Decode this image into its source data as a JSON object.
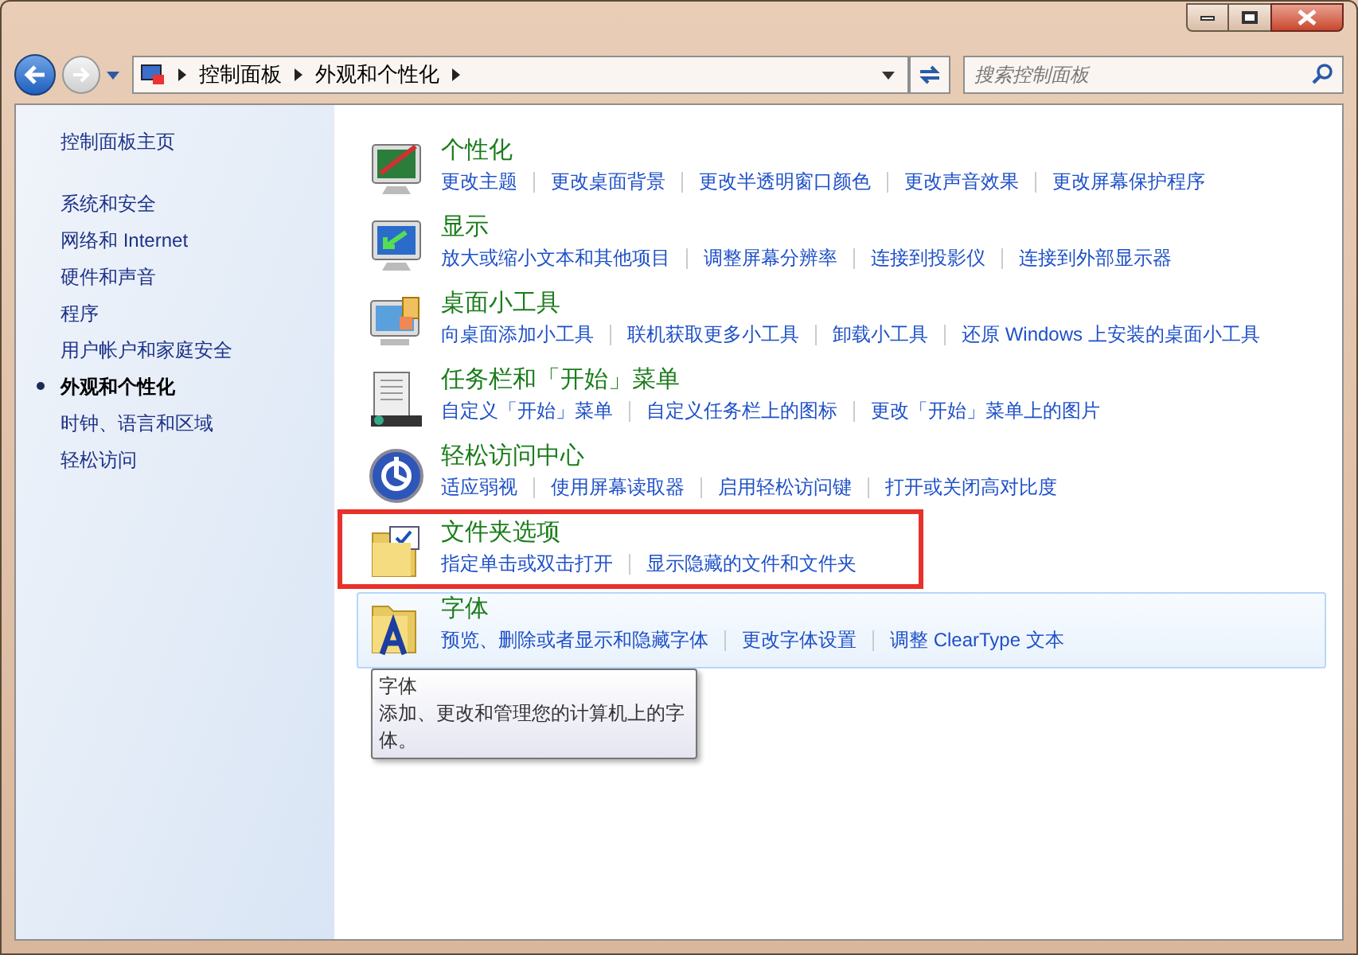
{
  "address_bar": {
    "segments": [
      "控制面板",
      "外观和个性化"
    ]
  },
  "search": {
    "placeholder": "搜索控制面板"
  },
  "sidebar": {
    "home": "控制面板主页",
    "items": [
      {
        "label": "系统和安全",
        "selected": false
      },
      {
        "label": "网络和 Internet",
        "selected": false
      },
      {
        "label": "硬件和声音",
        "selected": false
      },
      {
        "label": "程序",
        "selected": false
      },
      {
        "label": "用户帐户和家庭安全",
        "selected": false
      },
      {
        "label": "外观和个性化",
        "selected": true
      },
      {
        "label": "时钟、语言和区域",
        "selected": false
      },
      {
        "label": "轻松访问",
        "selected": false
      }
    ]
  },
  "categories": [
    {
      "kind": "monitor-brush",
      "title": "个性化",
      "hovered": false,
      "highlighted": false,
      "links": [
        "更改主题",
        "更改桌面背景",
        "更改半透明窗口颜色",
        "更改声音效果",
        "更改屏幕保护程序"
      ]
    },
    {
      "kind": "monitor-arrow",
      "title": "显示",
      "hovered": false,
      "highlighted": false,
      "links": [
        "放大或缩小文本和其他项目",
        "调整屏幕分辨率",
        "连接到投影仪",
        "连接到外部显示器"
      ]
    },
    {
      "kind": "monitor-gadget",
      "title": "桌面小工具",
      "hovered": false,
      "highlighted": false,
      "links": [
        "向桌面添加小工具",
        "联机获取更多小工具",
        "卸载小工具",
        "还原 Windows 上安装的桌面小工具"
      ]
    },
    {
      "kind": "taskbar",
      "title": "任务栏和「开始」菜单",
      "hovered": false,
      "highlighted": false,
      "links": [
        "自定义「开始」菜单",
        "自定义任务栏上的图标",
        "更改「开始」菜单上的图片"
      ]
    },
    {
      "kind": "access",
      "title": "轻松访问中心",
      "hovered": false,
      "highlighted": false,
      "links": [
        "适应弱视",
        "使用屏幕读取器",
        "启用轻松访问键",
        "打开或关闭高对比度"
      ]
    },
    {
      "kind": "folder-check",
      "title": "文件夹选项",
      "hovered": false,
      "highlighted": true,
      "links": [
        "指定单击或双击打开",
        "显示隐藏的文件和文件夹"
      ]
    },
    {
      "kind": "folder-font",
      "title": "字体",
      "hovered": true,
      "highlighted": false,
      "links": [
        "预览、删除或者显示和隐藏字体",
        "更改字体设置",
        "调整 ClearType 文本"
      ]
    }
  ],
  "tooltip": {
    "title": "字体",
    "text": "添加、更改和管理您的计算机上的字体。"
  }
}
